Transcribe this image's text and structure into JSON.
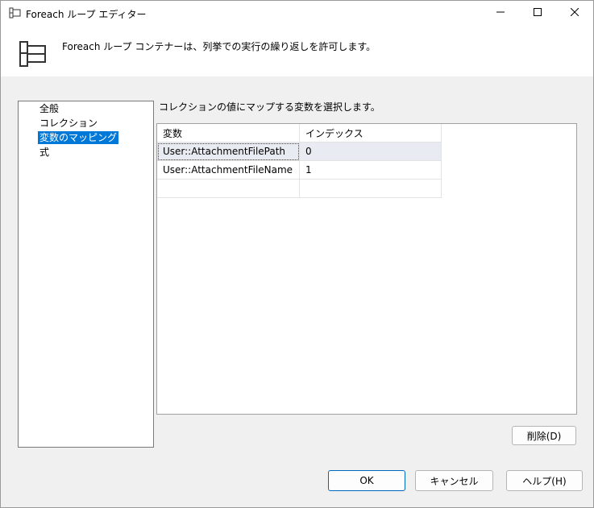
{
  "window": {
    "title": "Foreach ループ エディター",
    "icon": "foreach-loop-icon"
  },
  "header": {
    "description": "Foreach ループ コンテナーは、列挙での実行の繰り返しを許可します。",
    "icon": "container-icon"
  },
  "nav": {
    "items": [
      {
        "label": "全般",
        "selected": false
      },
      {
        "label": "コレクション",
        "selected": false
      },
      {
        "label": "変数のマッピング",
        "selected": true
      },
      {
        "label": "式",
        "selected": false
      }
    ]
  },
  "main": {
    "description": "コレクションの値にマップする変数を選択します。",
    "grid": {
      "columns": [
        "変数",
        "インデックス"
      ],
      "rows": [
        {
          "variable": "User::AttachmentFilePath",
          "index": "0"
        },
        {
          "variable": "User::AttachmentFileName",
          "index": "1"
        },
        {
          "variable": "",
          "index": ""
        }
      ]
    },
    "delete_label": "削除(D)"
  },
  "footer": {
    "ok_label": "OK",
    "cancel_label": "キャンセル",
    "help_label": "ヘルプ(H)"
  }
}
